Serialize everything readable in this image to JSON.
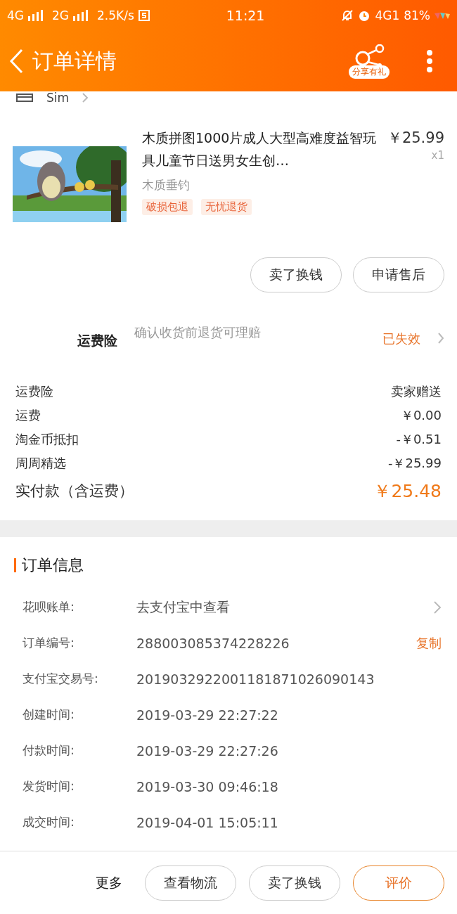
{
  "status_bar": {
    "left": [
      "4G",
      "2G"
    ],
    "speed": "2.5K/s",
    "time": "11:21",
    "network": "4G1",
    "battery": "81%"
  },
  "header": {
    "title": "订单详情",
    "share_label": "分享有礼"
  },
  "shop": {
    "name": "Sim"
  },
  "product": {
    "title": "木质拼图1000片成人大型高难度益智玩具儿童节日送男女生创…",
    "price": "￥25.99",
    "quantity": "x1",
    "spec": "木质垂钓",
    "tags": [
      "破损包退",
      "无忧退货"
    ]
  },
  "product_actions": [
    "卖了换钱",
    "申请售后"
  ],
  "insurance": {
    "label": "运费险",
    "description": "确认收货前退货可理赔",
    "status": "已失效"
  },
  "fees": [
    {
      "label": "运费险",
      "value": "卖家赠送",
      "kind": "plain"
    },
    {
      "label": "运费",
      "value": "￥0.00",
      "kind": "plain"
    },
    {
      "label": "淘金币抵扣",
      "value": "-￥0.51",
      "kind": "plain"
    },
    {
      "label": "周周精选",
      "value": "-￥25.99",
      "kind": "plain"
    },
    {
      "label": "实付款（含运费）",
      "value": "￥25.48",
      "kind": "total"
    }
  ],
  "order_info": {
    "title": "订单信息",
    "rows": [
      {
        "label": "花呗账单:",
        "value": "去支付宝中查看",
        "has_link": true
      },
      {
        "label": "订单编号:",
        "value": "288003085374228226",
        "copy": "复制"
      },
      {
        "label": "支付宝交易号:",
        "value": "2019032922001181871026090143"
      },
      {
        "label": "创建时间:",
        "value": "2019-03-29 22:27:22"
      },
      {
        "label": "付款时间:",
        "value": "2019-03-29 22:27:26"
      },
      {
        "label": "发货时间:",
        "value": "2019-03-30 09:46:18"
      },
      {
        "label": "成交时间:",
        "value": "2019-04-01 15:05:11"
      }
    ]
  },
  "bottom_bar": {
    "more": "更多",
    "buttons": [
      {
        "label": "查看物流",
        "primary": false
      },
      {
        "label": "卖了换钱",
        "primary": false
      },
      {
        "label": "评价",
        "primary": true
      }
    ]
  }
}
